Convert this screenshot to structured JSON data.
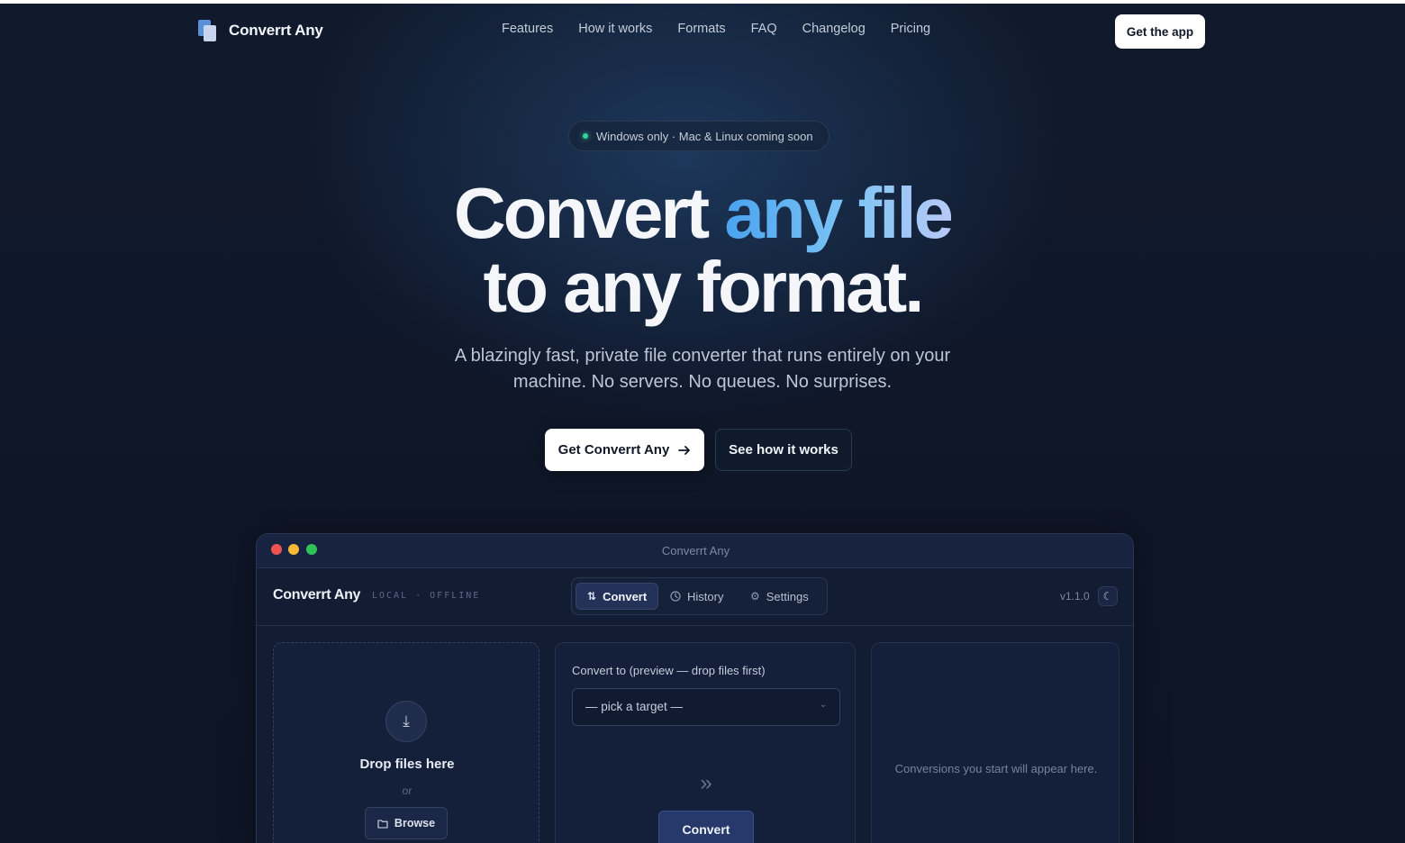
{
  "nav": {
    "brand": "Converrt Any",
    "links": [
      "Features",
      "How it works",
      "Formats",
      "FAQ",
      "Changelog",
      "Pricing"
    ],
    "cta": "Get the app"
  },
  "hero": {
    "badge": "Windows only · Mac & Linux coming soon",
    "title_line1_plain": "Convert ",
    "title_line1_accent": "any file",
    "title_line2": "to any format.",
    "subtitle": "A blazingly fast, private file converter that runs entirely on your machine. No servers. No queues. No surprises.",
    "primary_button": "Get Converrt Any",
    "primary_button_icon": "arrow-right-icon",
    "secondary_button": "See how it works"
  },
  "app": {
    "window_title": "Converrt Any",
    "name": "Converrt Any",
    "tag": "LOCAL · OFFLINE",
    "tabs": [
      {
        "label": "Convert",
        "icon": "swap-icon",
        "active": true
      },
      {
        "label": "History",
        "icon": "clock-icon",
        "active": false
      },
      {
        "label": "Settings",
        "icon": "gear-icon",
        "active": false
      }
    ],
    "version": "v1.1.0",
    "drop": {
      "title": "Drop files here",
      "or": "or",
      "browse": "Browse"
    },
    "convert": {
      "label": "Convert to (preview — drop files first)",
      "select_value": "— pick a target —",
      "button": "Convert"
    },
    "history": {
      "empty": "Conversions you start will appear here."
    }
  },
  "colors": {
    "background": "#0d1424",
    "accent_blue": "#4aa3f0",
    "status_green": "#34d399",
    "traffic_red": "#ef5350",
    "traffic_yellow": "#f5b935",
    "traffic_green": "#2fc556"
  }
}
